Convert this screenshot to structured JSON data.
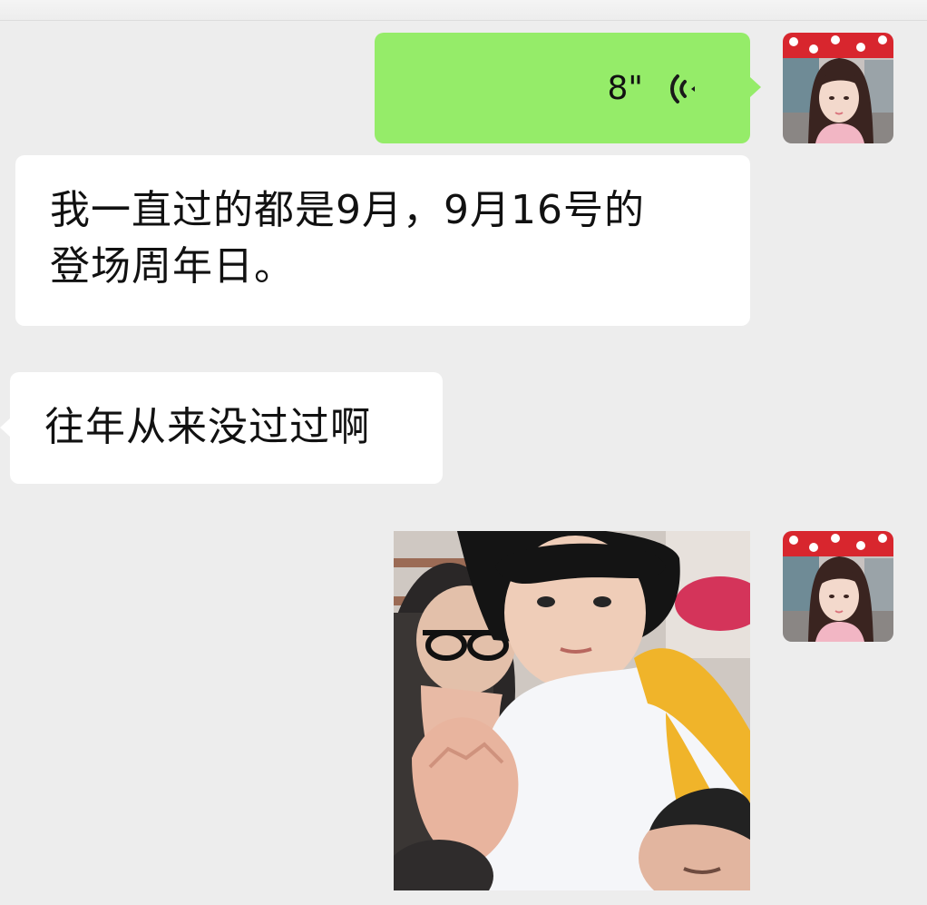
{
  "chat": {
    "messages": [
      {
        "type": "voice",
        "direction": "outgoing",
        "duration": "8\"",
        "icon": "voice-wave-icon"
      },
      {
        "type": "text",
        "direction": "incoming",
        "text": "我一直过的都是9月，9月16号的\n登场周年日。"
      },
      {
        "type": "text",
        "direction": "incoming",
        "text": "往年从来没过过啊"
      },
      {
        "type": "image",
        "direction": "outgoing",
        "content": "photo-sticker"
      }
    ],
    "self_avatar": "user-avatar",
    "colors": {
      "background": "#ededed",
      "outgoing_bubble": "#95ec69",
      "incoming_bubble": "#ffffff",
      "voice_icon": "#1a1a1a"
    }
  }
}
